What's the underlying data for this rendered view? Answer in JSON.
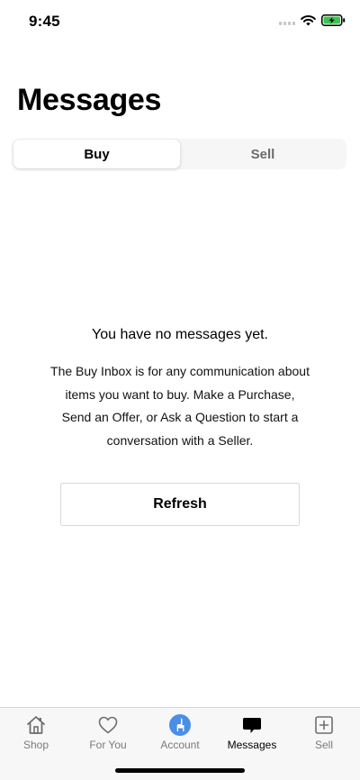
{
  "status_bar": {
    "time": "9:45"
  },
  "page": {
    "title": "Messages"
  },
  "segmented_control": {
    "selected": "Buy",
    "options": [
      {
        "label": "Buy"
      },
      {
        "label": "Sell"
      }
    ]
  },
  "empty_state": {
    "title": "You have no messages yet.",
    "description": "The Buy Inbox is for any communication about items you want to buy. Make a Purchase, Send an Offer, or Ask a Question to start a conversation with a Seller.",
    "button_label": "Refresh"
  },
  "tab_bar": {
    "active": "Messages",
    "accent_color": "#4a8ee6",
    "tabs": [
      {
        "label": "Shop",
        "icon": "home-icon"
      },
      {
        "label": "For You",
        "icon": "heart-icon"
      },
      {
        "label": "Account",
        "icon": "llama-avatar-icon"
      },
      {
        "label": "Messages",
        "icon": "chat-bubble-icon"
      },
      {
        "label": "Sell",
        "icon": "plus-square-icon"
      }
    ]
  }
}
